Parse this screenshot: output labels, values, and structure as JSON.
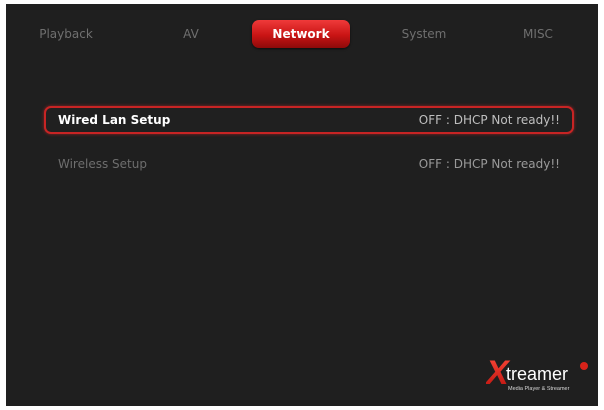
{
  "tabs": {
    "playback": "Playback",
    "av": "AV",
    "network": "Network",
    "system": "System",
    "misc": "MISC"
  },
  "menu": {
    "wired": {
      "label": "Wired Lan Setup",
      "status": "OFF : DHCP Not ready!!"
    },
    "wireless": {
      "label": "Wireless Setup",
      "status": "OFF : DHCP Not ready!!"
    }
  },
  "logo": {
    "brand_initial": "X",
    "brand_rest": "treamer",
    "tagline": "Media Player & Streamer"
  },
  "colors": {
    "accent": "#c91414",
    "background": "#1f1f1f"
  }
}
